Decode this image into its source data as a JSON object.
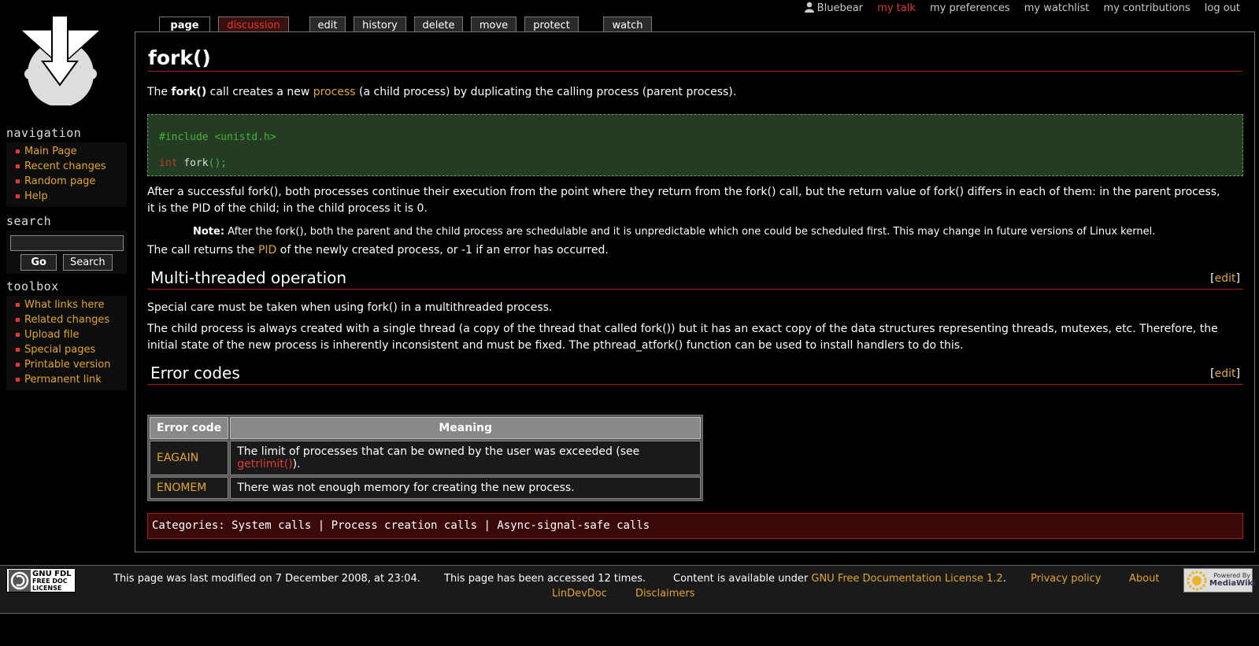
{
  "personal": {
    "user": "Bluebear",
    "talk": "my talk",
    "preferences": "my preferences",
    "watchlist": "my watchlist",
    "contributions": "my contributions",
    "logout": "log out"
  },
  "tabs": {
    "page": "page",
    "discussion": "discussion",
    "edit": "edit",
    "history": "history",
    "delete": "delete",
    "move": "move",
    "protect": "protect",
    "watch": "watch"
  },
  "sidebar": {
    "navigation_title": "navigation",
    "navigation": [
      "Main Page",
      "Recent changes",
      "Random page",
      "Help"
    ],
    "search_title": "search",
    "search_value": "",
    "go_label": "Go",
    "search_label": "Search",
    "toolbox_title": "toolbox",
    "toolbox": [
      "What links here",
      "Related changes",
      "Upload file",
      "Special pages",
      "Printable version",
      "Permanent link"
    ]
  },
  "article": {
    "title": "fork()",
    "intro_1": "The ",
    "intro_bold": "fork()",
    "intro_2": " call creates a new ",
    "intro_link": "process",
    "intro_3": " (a child process) by duplicating the calling process (parent process).",
    "code_include": "#include <unistd.h>",
    "code_kw": "int",
    "code_fn": "fork",
    "code_punct": "();",
    "para_after": "After a successful fork(), both processes continue their execution from the point where they return from the fork() call, but the return value of fork() differs in each of them: in the parent process, it is the PID of the child; in the child process it is 0.",
    "note_label": "Note:",
    "note_text": " After the fork(), both the parent and the child process are schedulable and it is unpredictable which one could be scheduled first. This may change in future versions of Linux kernel.",
    "returns_1": "The call returns the ",
    "returns_link": "PID",
    "returns_2": " of the newly created process, or -1 if an error has occurred.",
    "section1_title": "Multi-threaded operation",
    "edit_label": "edit",
    "section1_p1": "Special care must be taken when using fork() in a multithreaded process.",
    "section1_p2": "The child process is always created with a single thread (a copy of the thread that called fork()) but it has an exact copy of the data structures representing threads, mutexes, etc. Therefore, the initial state of the new process is inherently inconsistent and must be fixed. The pthread_atfork() function can be used to install handlers to do this.",
    "section2_title": "Error codes",
    "table": {
      "headers": [
        "Error code",
        "Meaning"
      ],
      "rows": [
        {
          "code": "EAGAIN",
          "meaning_1": "The limit of processes that can be owned by the user was exceeded (see ",
          "meaning_link": "getrlimit()",
          "meaning_2": ")."
        },
        {
          "code": "ENOMEM",
          "meaning_1": "There was not enough memory for creating the new process.",
          "meaning_link": "",
          "meaning_2": ""
        }
      ]
    },
    "categories_label": "Categories:",
    "categories": [
      "System calls",
      "Process creation calls",
      "Async-signal-safe calls"
    ],
    "categories_sep": "|"
  },
  "footer": {
    "last_modified": "This page was last modified on 7 December 2008, at 23:04.",
    "accessed": "This page has been accessed 12 times.",
    "license_prefix": "Content is available under ",
    "license_link": "GNU Free Documentation License 1.2",
    "license_suffix": ".",
    "privacy": "Privacy policy",
    "about": "About LinDevDoc",
    "disclaimers": "Disclaimers",
    "gnu_badge": [
      "GNU FDL",
      "FREE DOC",
      "LICENSE"
    ],
    "mw_badge": [
      "Powered By",
      "MediaWiki"
    ]
  }
}
